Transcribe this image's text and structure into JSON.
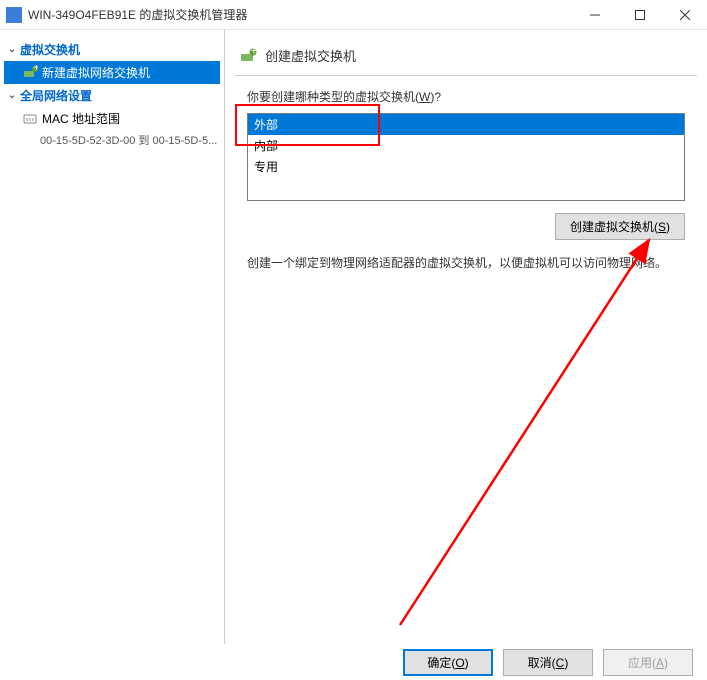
{
  "titlebar": {
    "title": "WIN-349O4FEB91E 的虚拟交换机管理器"
  },
  "sidebar": {
    "section1": {
      "label": "虚拟交换机",
      "item_new": "新建虚拟网络交换机"
    },
    "section2": {
      "label": "全局网络设置",
      "mac_label": "MAC 地址范围",
      "mac_value": "00-15-5D-52-3D-00 到 00-15-5D-5..."
    }
  },
  "main": {
    "header": "创建虚拟交换机",
    "question_prefix": "你要创建哪种类型的虚拟交换机(",
    "question_key": "W",
    "question_suffix": ")?",
    "options": {
      "external": "外部",
      "internal": "内部",
      "private": "专用"
    },
    "create_btn_prefix": "创建虚拟交换机(",
    "create_btn_key": "S",
    "create_btn_suffix": ")",
    "description": "创建一个绑定到物理网络适配器的虚拟交换机，以便虚拟机可以访问物理网络。"
  },
  "footer": {
    "ok_prefix": "确定(",
    "ok_key": "O",
    "ok_suffix": ")",
    "cancel_prefix": "取消(",
    "cancel_key": "C",
    "cancel_suffix": ")",
    "apply_prefix": "应用(",
    "apply_key": "A",
    "apply_suffix": ")"
  }
}
